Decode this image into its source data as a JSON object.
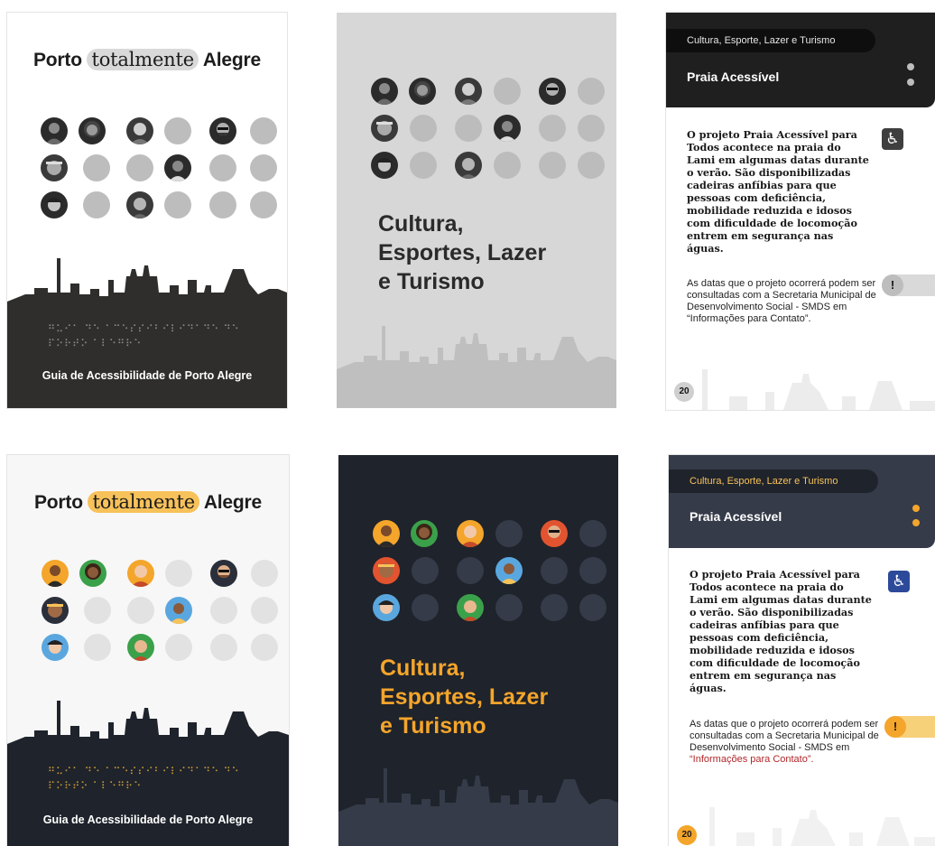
{
  "covers": {
    "title_before": "Porto",
    "title_highlight": "totalmente",
    "title_after": "Alegre",
    "braille_line1": "⠛⠥⠊⠁ ⠙⠑ ⠁⠉⠑⠎⠎⠊⠃⠊⠇⠊⠙⠁⠙⠑ ⠙⠑",
    "braille_line2": "⠏⠕⠗⠞⠕ ⠁⠇⠑⠛⠗⠑",
    "guide_label": "Guia de Acessibilidade de Porto Alegre"
  },
  "section": {
    "title_line1": "Cultura,",
    "title_line2": "Esportes, Lazer",
    "title_line3": "e Turismo"
  },
  "inner": {
    "category": "Cultura, Esporte, Lazer e Turismo",
    "title": "Praia Acessível",
    "paragraph": "O projeto Praia Acessível para Todos acontece na praia do Lami em algumas datas durante o verão. São disponibilizadas cadeiras anfíbias para que pessoas com deficiência, mobilidade reduzida e idosos com dificuldade de locomoção entrem em segurança nas águas.",
    "note_main": "As datas que o projeto ocorrerá podem ser consultadas com a Secretaria Municipal de Desenvolvimento Social - SMDS em",
    "note_link": "“Informações para Contato”.",
    "accessibility_glyph": "♿",
    "alert_glyph": "!",
    "page_number": "20"
  },
  "icons": [
    "accessibility-icon",
    "alert-icon"
  ],
  "colors": {
    "mono_dark": "#2f2e2c",
    "mono_gray": "#bdbdbd",
    "mono_bg": "#d7d7d7",
    "color_dark": "#1f232b",
    "color_navy": "#353b49",
    "color_accent": "#f7c25a",
    "link_red": "#b2262a",
    "badge_blue": "#2d4a9a"
  }
}
